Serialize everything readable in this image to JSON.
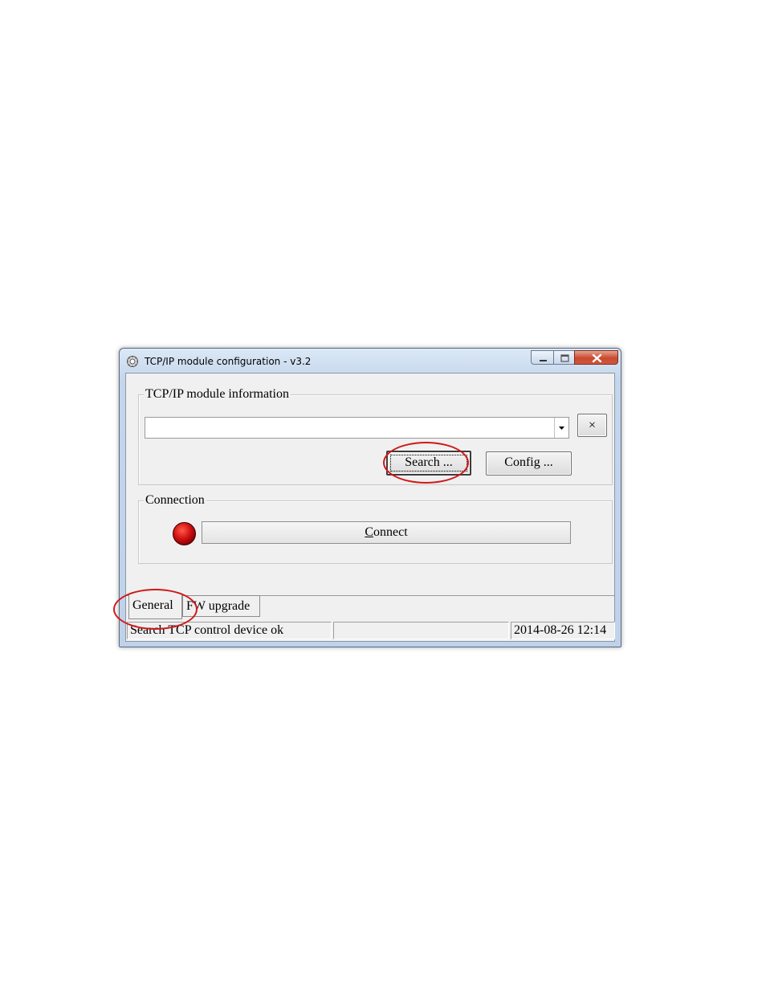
{
  "window": {
    "title": "TCP/IP module configuration - v3.2"
  },
  "module_info": {
    "group_label": "TCP/IP module information",
    "combo_value": "",
    "clear_label": "×",
    "search_label": "Search ...",
    "config_label": "Config ..."
  },
  "connection": {
    "group_label": "Connection",
    "connect_label_accel": "C",
    "connect_label_rest": "onnect",
    "status_led_color": "#cc1010"
  },
  "tabs": [
    {
      "label": "General",
      "active": true
    },
    {
      "label": "FW upgrade",
      "active": false
    }
  ],
  "statusbar": {
    "message": "Search TCP control device ok",
    "middle": "",
    "datetime": "2014-08-26 12:14"
  },
  "annotation_color": "#d01818"
}
